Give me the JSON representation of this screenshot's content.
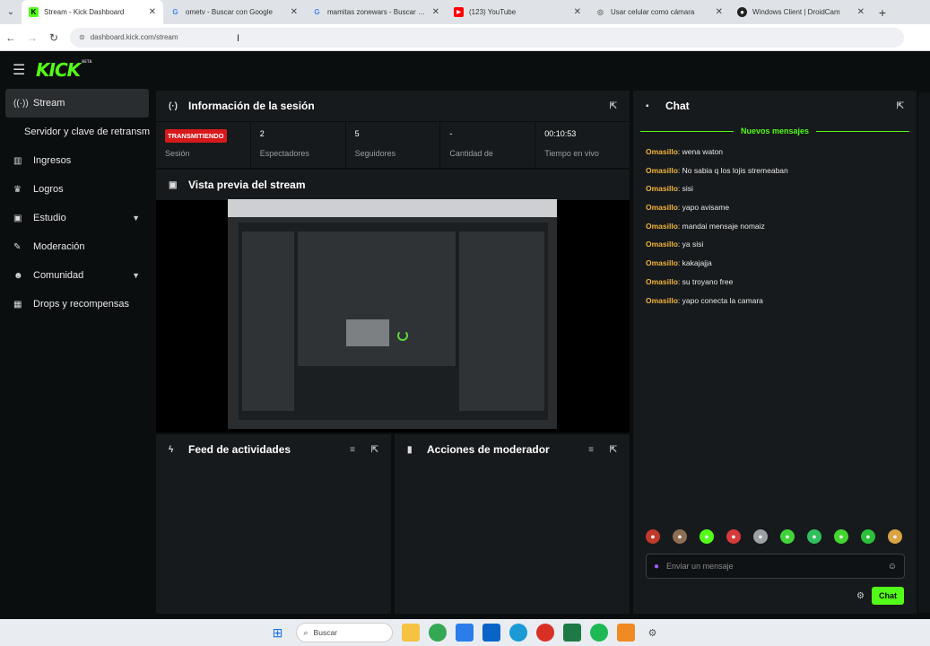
{
  "browser": {
    "tabs": [
      {
        "title": "Stream - Kick Dashboard",
        "icon": "kick-icon",
        "active": true
      },
      {
        "title": "ometv - Buscar con Google",
        "icon": "google-icon",
        "active": false
      },
      {
        "title": "mamitas zonewars - Buscar con",
        "icon": "google-icon",
        "active": false
      },
      {
        "title": "(123) YouTube",
        "icon": "youtube-icon",
        "active": false
      },
      {
        "title": "Usar celular como cámara",
        "icon": "web-icon",
        "active": false
      },
      {
        "title": "Windows Client | DroidCam",
        "icon": "droidcam-icon",
        "active": false
      }
    ],
    "url": "dashboard.kick.com/stream"
  },
  "app": {
    "logo": "KICK",
    "logo_tag": "BETA",
    "accent": "#53fc18"
  },
  "sidebar": {
    "items": [
      {
        "label": "Stream",
        "icon": "broadcast-icon",
        "active": true
      },
      {
        "label": "Servidor y clave de retransm",
        "icon": "",
        "sub": true
      },
      {
        "label": "Ingresos",
        "icon": "chart-icon"
      },
      {
        "label": "Logros",
        "icon": "trophy-icon"
      },
      {
        "label": "Estudio",
        "icon": "studio-icon",
        "expandable": true
      },
      {
        "label": "Moderación",
        "icon": "wrench-icon"
      },
      {
        "label": "Comunidad",
        "icon": "community-icon",
        "expandable": true
      },
      {
        "label": "Drops y recompensas",
        "icon": "drops-icon"
      }
    ]
  },
  "session": {
    "title": "Información de la sesión",
    "status_badge": "TRANSMITIENDO",
    "stats": [
      {
        "value": "",
        "label": "Sesión"
      },
      {
        "value": "2",
        "label": "Espectadores"
      },
      {
        "value": "5",
        "label": "Seguidores"
      },
      {
        "value": "-",
        "label": "Cantidad de"
      },
      {
        "value": "00:10:53",
        "label": "Tiempo en vivo"
      }
    ]
  },
  "preview": {
    "title": "Vista previa del stream"
  },
  "activity": {
    "title": "Feed de actividades"
  },
  "moderator": {
    "title": "Acciones de moderador"
  },
  "chat": {
    "title": "Chat",
    "new_messages": "Nuevos mensajes",
    "messages": [
      {
        "user": "Omasillo",
        "text": ": wena waton"
      },
      {
        "user": "Omasillo",
        "text": ": No sabia q los lojis stremeaban"
      },
      {
        "user": "Omasillo",
        "text": ": sisi"
      },
      {
        "user": "Omasillo",
        "text": ": yapo avisame"
      },
      {
        "user": "Omasillo",
        "text": ": mandai mensaje nomaiz"
      },
      {
        "user": "Omasillo",
        "text": ": ya sisi"
      },
      {
        "user": "Omasillo",
        "text": ": kakajajja"
      },
      {
        "user": "Omasillo",
        "text": ": su troyano free"
      },
      {
        "user": "Omasillo",
        "text": ": yapo conecta la camara"
      }
    ],
    "input_placeholder": "Enviar un mensaje",
    "send_label": "Chat"
  },
  "taskbar": {
    "search_placeholder": "Buscar"
  }
}
